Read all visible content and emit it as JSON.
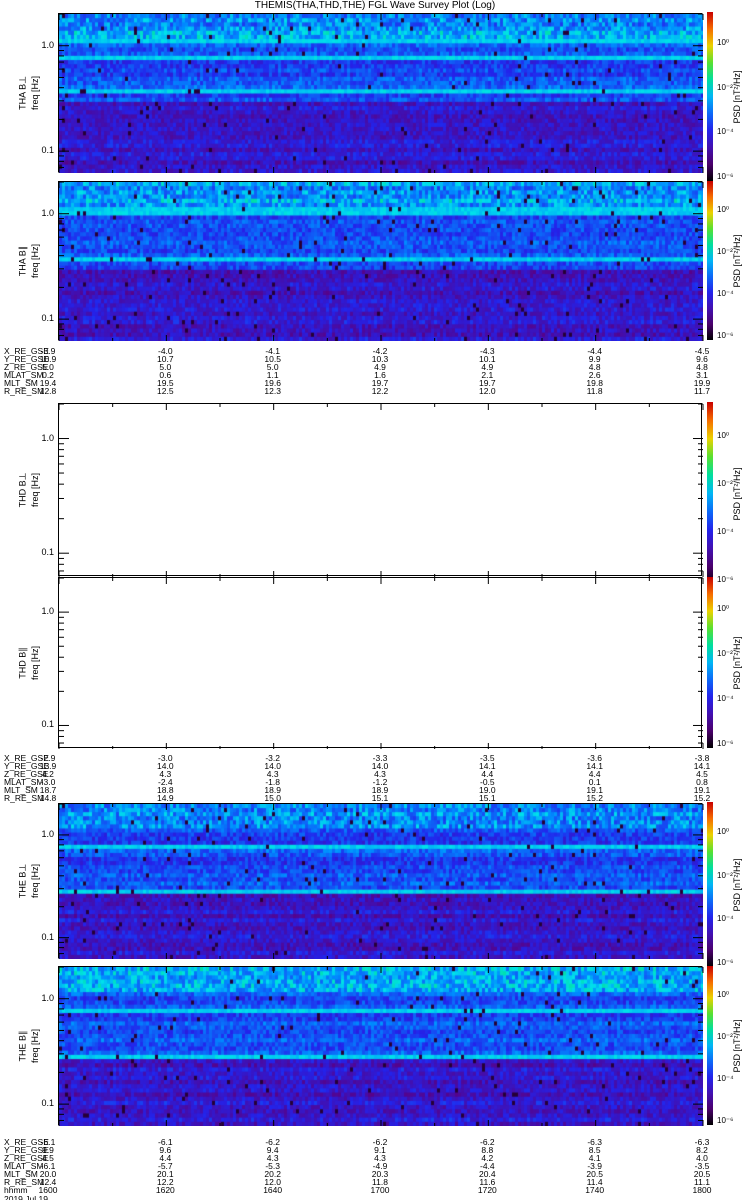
{
  "title": "THEMIS(THA,THD,THE) FGL Wave Survey Plot (Log)",
  "colorbar": {
    "label": "PSD [nT²/Hz]",
    "ticks": [
      "10⁰",
      "10⁻²",
      "10⁻⁴",
      "10⁻⁶"
    ]
  },
  "yticks": [
    "1.0",
    "0.1"
  ],
  "chart_data": {
    "type": "heatmap",
    "title": "THEMIS(THA,THD,THE) FGL Wave Survey Plot (Log)",
    "yscale": "log",
    "ylim": [
      0.062,
      2.0
    ],
    "ylabel": "freq [Hz]",
    "zlabel": "PSD [nT²/Hz]",
    "zlim_log10": [
      -6.2,
      1.4
    ],
    "x_ticks": [
      "1600",
      "1620",
      "1640",
      "1700",
      "1720",
      "1740",
      "1800"
    ],
    "panels": [
      {
        "label": "THA B⊥",
        "ylabel": "freq [Hz]",
        "has_data": true,
        "bright_bands_hz": [
          1.1,
          0.78,
          0.38
        ]
      },
      {
        "label": "THA B∥",
        "ylabel": "freq [Hz]",
        "has_data": true,
        "bright_bands_hz": [
          1.05,
          0.38
        ]
      },
      {
        "label": "THD B⊥",
        "ylabel": "freq [Hz]",
        "has_data": false,
        "bright_bands_hz": []
      },
      {
        "label": "THD B∥",
        "ylabel": "freq [Hz]",
        "has_data": false,
        "bright_bands_hz": []
      },
      {
        "label": "THE B⊥",
        "ylabel": "freq [Hz]",
        "has_data": true,
        "bright_bands_hz": [
          0.75,
          0.28
        ]
      },
      {
        "label": "THE B∥",
        "ylabel": "freq [Hz]",
        "has_data": true,
        "bright_bands_hz": [
          0.75,
          0.28
        ]
      }
    ]
  },
  "ephemeris": [
    {
      "rows": [
        {
          "label": "X_RE_GSE",
          "values": [
            "-3.9",
            "-4.0",
            "-4.1",
            "-4.2",
            "-4.3",
            "-4.4",
            "-4.5"
          ]
        },
        {
          "label": "Y_RE_GSE",
          "values": [
            "10.9",
            "10.7",
            "10.5",
            "10.3",
            "10.1",
            "9.9",
            "9.6"
          ]
        },
        {
          "label": "Z_RE_GSE",
          "values": [
            "5.0",
            "5.0",
            "5.0",
            "4.9",
            "4.9",
            "4.8",
            "4.8"
          ]
        },
        {
          "label": "MLAT_SM",
          "values": [
            "0.2",
            "0.6",
            "1.1",
            "1.6",
            "2.1",
            "2.6",
            "3.1"
          ]
        },
        {
          "label": "MLT_SM",
          "values": [
            "19.4",
            "19.5",
            "19.6",
            "19.7",
            "19.7",
            "19.8",
            "19.9"
          ]
        },
        {
          "label": "R_RE_SM",
          "values": [
            "12.8",
            "12.5",
            "12.3",
            "12.2",
            "12.0",
            "11.8",
            "11.7"
          ]
        }
      ]
    },
    {
      "rows": [
        {
          "label": "X_RE_GSE",
          "values": [
            "-2.9",
            "-3.0",
            "-3.2",
            "-3.3",
            "-3.5",
            "-3.6",
            "-3.8"
          ]
        },
        {
          "label": "Y_RE_GSE",
          "values": [
            "13.9",
            "14.0",
            "14.0",
            "14.0",
            "14.1",
            "14.1",
            "14.1"
          ]
        },
        {
          "label": "Z_RE_GSE",
          "values": [
            "4.2",
            "4.3",
            "4.3",
            "4.3",
            "4.4",
            "4.4",
            "4.5"
          ]
        },
        {
          "label": "MLAT_SM",
          "values": [
            "-3.0",
            "-2.4",
            "-1.8",
            "-1.2",
            "-0.5",
            "0.1",
            "0.8"
          ]
        },
        {
          "label": "MLT_SM",
          "values": [
            "18.7",
            "18.8",
            "18.9",
            "18.9",
            "19.0",
            "19.1",
            "19.1"
          ]
        },
        {
          "label": "R_RE_SM",
          "values": [
            "14.8",
            "14.9",
            "15.0",
            "15.1",
            "15.1",
            "15.2",
            "15.2"
          ]
        }
      ]
    },
    {
      "rows": [
        {
          "label": "X_RE_GSE",
          "values": [
            "-6.1",
            "-6.1",
            "-6.2",
            "-6.2",
            "-6.2",
            "-6.3",
            "-6.3"
          ]
        },
        {
          "label": "Y_RE_GSE",
          "values": [
            "9.9",
            "9.6",
            "9.4",
            "9.1",
            "8.8",
            "8.5",
            "8.2"
          ]
        },
        {
          "label": "Z_RE_GSE",
          "values": [
            "4.5",
            "4.4",
            "4.3",
            "4.3",
            "4.2",
            "4.1",
            "4.0"
          ]
        },
        {
          "label": "MLAT_SM",
          "values": [
            "-6.1",
            "-5.7",
            "-5.3",
            "-4.9",
            "-4.4",
            "-3.9",
            "-3.5"
          ]
        },
        {
          "label": "MLT_SM",
          "values": [
            "20.0",
            "20.1",
            "20.2",
            "20.3",
            "20.4",
            "20.5",
            "20.5"
          ]
        },
        {
          "label": "R_RE_SM",
          "values": [
            "12.4",
            "12.2",
            "12.0",
            "11.8",
            "11.6",
            "11.4",
            "11.1"
          ]
        },
        {
          "label": "hhmm",
          "values": [
            "1600",
            "1620",
            "1640",
            "1700",
            "1720",
            "1740",
            "1800"
          ]
        }
      ],
      "date": "2019 Jul 19"
    }
  ]
}
